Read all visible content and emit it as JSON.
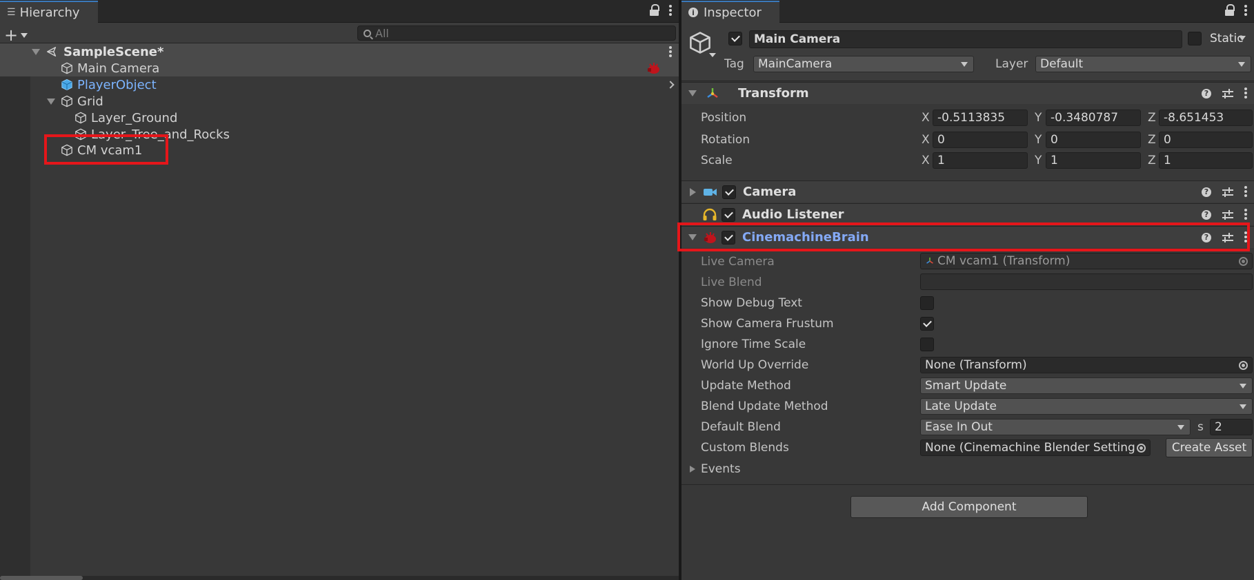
{
  "hierarchy": {
    "tab_title": "Hierarchy",
    "search_placeholder": "All",
    "scene": "SampleScene*",
    "items": [
      {
        "label": "Main Camera"
      },
      {
        "label": "PlayerObject"
      },
      {
        "label": "Grid"
      },
      {
        "label": "Layer_Ground"
      },
      {
        "label": "Layer_Tree_and_Rocks"
      },
      {
        "label": "CM vcam1"
      }
    ]
  },
  "inspector": {
    "tab_title": "Inspector",
    "object_name": "Main Camera",
    "static_label": "Static",
    "tag_label": "Tag",
    "tag_value": "MainCamera",
    "layer_label": "Layer",
    "layer_value": "Default",
    "transform": {
      "title": "Transform",
      "position_label": "Position",
      "rotation_label": "Rotation",
      "scale_label": "Scale",
      "axis_x": "X",
      "axis_y": "Y",
      "axis_z": "Z",
      "position": {
        "x": "-0.5113835",
        "y": "-0.3480787",
        "z": "-8.651453"
      },
      "rotation": {
        "x": "0",
        "y": "0",
        "z": "0"
      },
      "scale": {
        "x": "1",
        "y": "1",
        "z": "1"
      }
    },
    "camera_title": "Camera",
    "audio_title": "Audio Listener",
    "brain": {
      "title": "CinemachineBrain",
      "live_camera_label": "Live Camera",
      "live_camera_value": "CM vcam1 (Transform)",
      "live_blend_label": "Live Blend",
      "show_debug_label": "Show Debug Text",
      "show_frustum_label": "Show Camera Frustum",
      "ignore_time_label": "Ignore Time Scale",
      "world_up_label": "World Up Override",
      "world_up_value": "None (Transform)",
      "update_method_label": "Update Method",
      "update_method_value": "Smart Update",
      "blend_update_label": "Blend Update Method",
      "blend_update_value": "Late Update",
      "default_blend_label": "Default Blend",
      "default_blend_value": "Ease In Out",
      "default_blend_s": "s",
      "default_blend_time": "2",
      "custom_blends_label": "Custom Blends",
      "custom_blends_value": "None (Cinemachine Blender Setting",
      "create_asset": "Create Asset",
      "events_label": "Events"
    },
    "add_component": "Add Component"
  },
  "colors": {
    "selection_outline": "#e5161a",
    "prefab_blue": "#7cb4ff",
    "component_link": "#84a9f5"
  }
}
